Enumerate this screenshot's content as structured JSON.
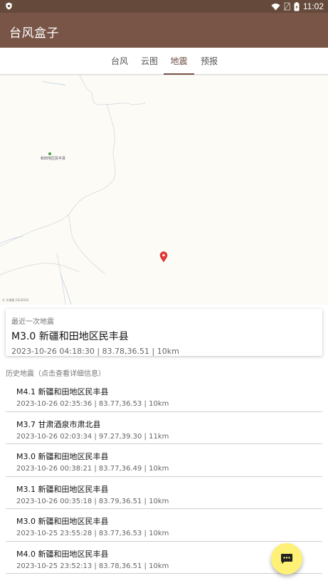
{
  "status_bar": {
    "time": "11:02"
  },
  "app": {
    "title": "台风盒子"
  },
  "tabs": [
    {
      "label": "台风"
    },
    {
      "label": "云图"
    },
    {
      "label": "地震",
      "active": true
    },
    {
      "label": "预报"
    }
  ],
  "map": {
    "place_label": "和田地区民丰县",
    "attribution": "© 天地图 GS(2023)"
  },
  "latest": {
    "label": "最近一次地震",
    "title": "M3.0 新疆和田地区民丰县",
    "meta": "2023-10-26 04:18:30 | 83.78,36.51 | 10km"
  },
  "history": {
    "label": "历史地震（点击查看详细信息）",
    "items": [
      {
        "title": "M4.1 新疆和田地区民丰县",
        "meta": "2023-10-26 02:35:36 | 83.77,36.53 | 10km"
      },
      {
        "title": "M3.7 甘肃酒泉市肃北县",
        "meta": "2023-10-26 02:03:34 | 97.27,39.30 | 11km"
      },
      {
        "title": "M3.0 新疆和田地区民丰县",
        "meta": "2023-10-26 00:38:21 | 83.77,36.49 | 10km"
      },
      {
        "title": "M3.1 新疆和田地区民丰县",
        "meta": "2023-10-26 00:35:18 | 83.79,36.51 | 10km"
      },
      {
        "title": "M3.0 新疆和田地区民丰县",
        "meta": "2023-10-25 23:55:28 | 83.77,36.53 | 10km"
      },
      {
        "title": "M4.0 新疆和田地区民丰县",
        "meta": "2023-10-25 23:52:13 | 83.78,36.51 | 10km"
      }
    ]
  },
  "colors": {
    "appbar": "#795548",
    "statusbar": "#654a3b",
    "fab": "#fff176",
    "marker": "#e53935"
  },
  "icons": {
    "fab": "chat-icon",
    "marker": "location-pin-icon"
  }
}
